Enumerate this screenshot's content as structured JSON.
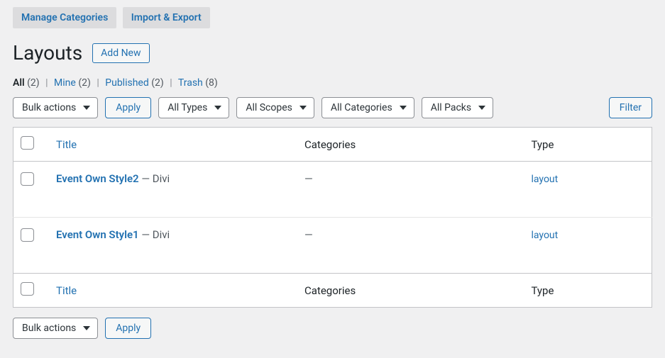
{
  "topTabs": {
    "manage": "Manage Categories",
    "importExport": "Import & Export"
  },
  "page": {
    "title": "Layouts",
    "addNew": "Add New"
  },
  "views": {
    "allLabel": "All",
    "allCount": "(2)",
    "mineLabel": "Mine",
    "mineCount": "(2)",
    "pubLabel": "Published",
    "pubCount": "(2)",
    "trashLabel": "Trash",
    "trashCount": "(8)"
  },
  "filters": {
    "bulk": "Bulk actions",
    "apply": "Apply",
    "types": "All Types",
    "scopes": "All Scopes",
    "categories": "All Categories",
    "packs": "All Packs",
    "filter": "Filter"
  },
  "cols": {
    "title": "Title",
    "categories": "Categories",
    "type": "Type"
  },
  "rows": [
    {
      "title": "Event Own Style2",
      "suffix": " — Divi",
      "categories": "—",
      "type": "layout"
    },
    {
      "title": "Event Own Style1",
      "suffix": " — Divi",
      "categories": "—",
      "type": "layout"
    }
  ]
}
